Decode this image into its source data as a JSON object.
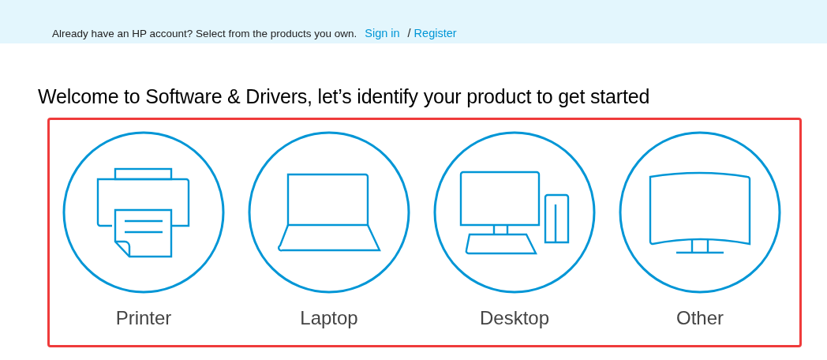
{
  "banner": {
    "text": "Already have an HP account? Select from the products you own.",
    "sign_in": "Sign in",
    "separator": "/",
    "register": "Register"
  },
  "heading": "Welcome to Software & Drivers, let’s identify your product to get started",
  "products": [
    {
      "kind": "printer",
      "label": "Printer"
    },
    {
      "kind": "laptop",
      "label": "Laptop"
    },
    {
      "kind": "desktop",
      "label": "Desktop"
    },
    {
      "kind": "monitor",
      "label": "Other"
    }
  ]
}
